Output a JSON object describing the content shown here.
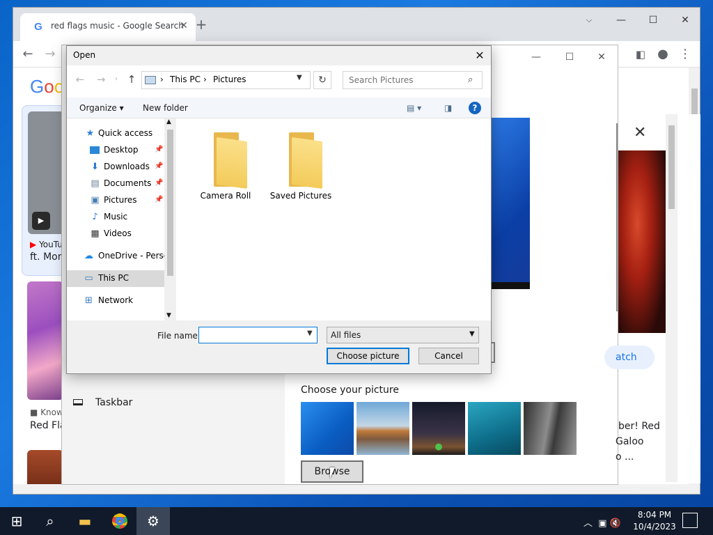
{
  "browser": {
    "tab_title": "red flags music - Google Search",
    "close_tab": "✕",
    "new_tab": "+",
    "partial_texts": {
      "youtube": "YouTu",
      "ft": "ft. Mon",
      "know": "Know",
      "redfla": "Red Fla"
    }
  },
  "settings": {
    "choose_picture_label": "Choose your picture",
    "browse_label": "Browse",
    "taskbar_nav_label": "Taskbar"
  },
  "side_panel": {
    "watch_label": "atch",
    "caption_lines": [
      "ber! Red",
      "Galoo",
      "o ..."
    ]
  },
  "dialog": {
    "title": "Open",
    "address": {
      "root": "This PC",
      "folder": "Pictures"
    },
    "search_placeholder": "Search Pictures",
    "organize_label": "Organize ▾",
    "new_folder_label": "New folder",
    "help_label": "?",
    "nav_items": [
      {
        "label": "Quick access",
        "icon": "star-icon"
      },
      {
        "label": "Desktop",
        "icon": "desktop-icon"
      },
      {
        "label": "Downloads",
        "icon": "download-icon"
      },
      {
        "label": "Documents",
        "icon": "document-icon"
      },
      {
        "label": "Pictures",
        "icon": "pictures-icon"
      },
      {
        "label": "Music",
        "icon": "music-icon"
      },
      {
        "label": "Videos",
        "icon": "video-icon"
      },
      {
        "label": "OneDrive - Persor",
        "icon": "cloud-icon"
      },
      {
        "label": "This PC",
        "icon": "computer-icon"
      },
      {
        "label": "Network",
        "icon": "network-icon"
      }
    ],
    "folders": [
      "Camera Roll",
      "Saved Pictures"
    ],
    "file_name_label": "File name:",
    "file_name_value": "",
    "file_filter": "All files",
    "choose_button": "Choose picture",
    "cancel_button": "Cancel"
  },
  "taskbar": {
    "time": "8:04 PM",
    "date": "10/4/2023"
  },
  "colors": {
    "accent": "#0078d7",
    "taskbar_bg": "#101a2a",
    "folder_yellow": "#f3cb5a"
  }
}
